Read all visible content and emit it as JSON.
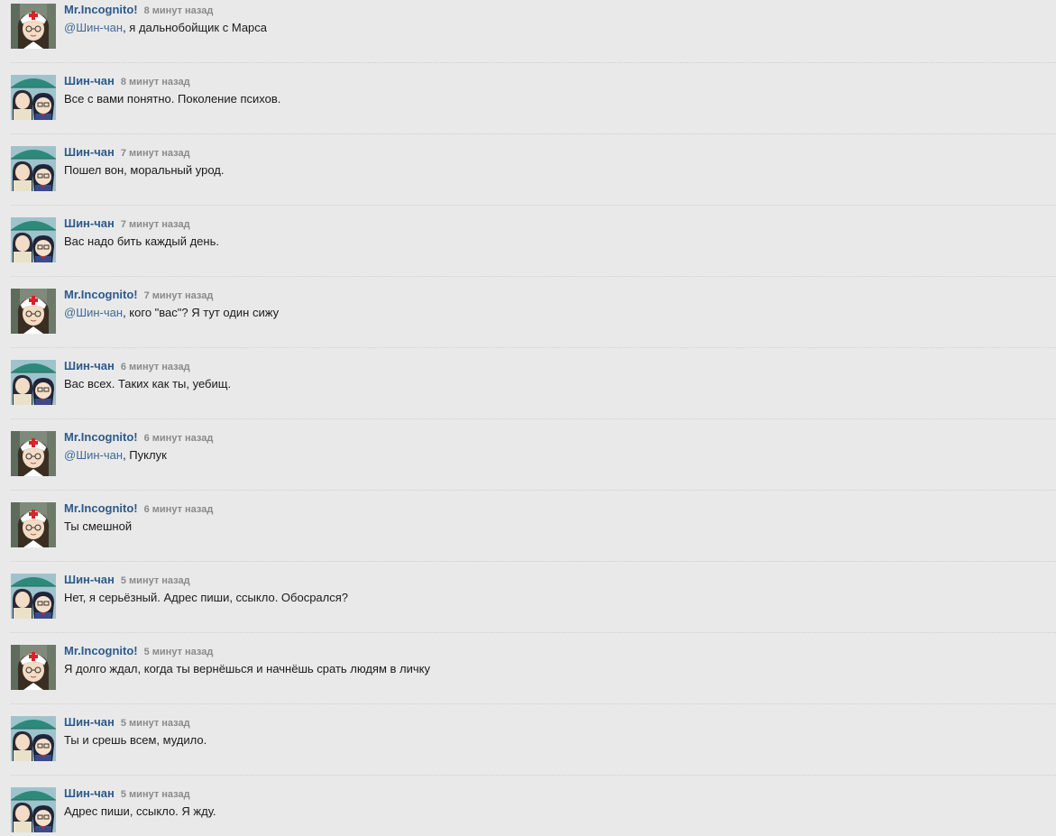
{
  "messages": [
    {
      "author": "Mr.Incognito!",
      "avatar": "nurse-avatar",
      "time": "8 минут назад",
      "mention": "@Шин-чан",
      "text": ", я дальнобойщик с Марса"
    },
    {
      "author": "Шин-чан",
      "avatar": "umbrella-avatar",
      "time": "8 минут назад",
      "mention": "",
      "text": "Все с вами понятно. Поколение психов."
    },
    {
      "author": "Шин-чан",
      "avatar": "umbrella-avatar",
      "time": "7 минут назад",
      "mention": "",
      "text": "Пошел вон, моральный урод."
    },
    {
      "author": "Шин-чан",
      "avatar": "umbrella-avatar",
      "time": "7 минут назад",
      "mention": "",
      "text": "Вас надо бить каждый день."
    },
    {
      "author": "Mr.Incognito!",
      "avatar": "nurse-avatar",
      "time": "7 минут назад",
      "mention": "@Шин-чан",
      "text": ", кого \"вас\"? Я тут один сижу"
    },
    {
      "author": "Шин-чан",
      "avatar": "umbrella-avatar",
      "time": "6 минут назад",
      "mention": "",
      "text": "Вас всех. Таких как ты, уебищ."
    },
    {
      "author": "Mr.Incognito!",
      "avatar": "nurse-avatar",
      "time": "6 минут назад",
      "mention": "@Шин-чан",
      "text": ", Пуклук"
    },
    {
      "author": "Mr.Incognito!",
      "avatar": "nurse-avatar",
      "time": "6 минут назад",
      "mention": "",
      "text": "Ты смешной"
    },
    {
      "author": "Шин-чан",
      "avatar": "umbrella-avatar",
      "time": "5 минут назад",
      "mention": "",
      "text": "Нет, я серьёзный. Адрес пиши, ссыкло. Обосрался?"
    },
    {
      "author": "Mr.Incognito!",
      "avatar": "nurse-avatar",
      "time": "5 минут назад",
      "mention": "",
      "text": "Я долго ждал, когда ты вернёшься и начнёшь срать людям в личку"
    },
    {
      "author": "Шин-чан",
      "avatar": "umbrella-avatar",
      "time": "5 минут назад",
      "mention": "",
      "text": "Ты и срешь всем, мудило."
    },
    {
      "author": "Шин-чан",
      "avatar": "umbrella-avatar",
      "time": "5 минут назад",
      "mention": "",
      "text": "Адрес пиши, ссыкло. Я жду."
    }
  ],
  "colors": {
    "background": "#e9e9e9",
    "author": "#2c5a8a",
    "time": "#8a8a8a",
    "text": "#1a1a1a",
    "mention": "#3d6a99"
  }
}
